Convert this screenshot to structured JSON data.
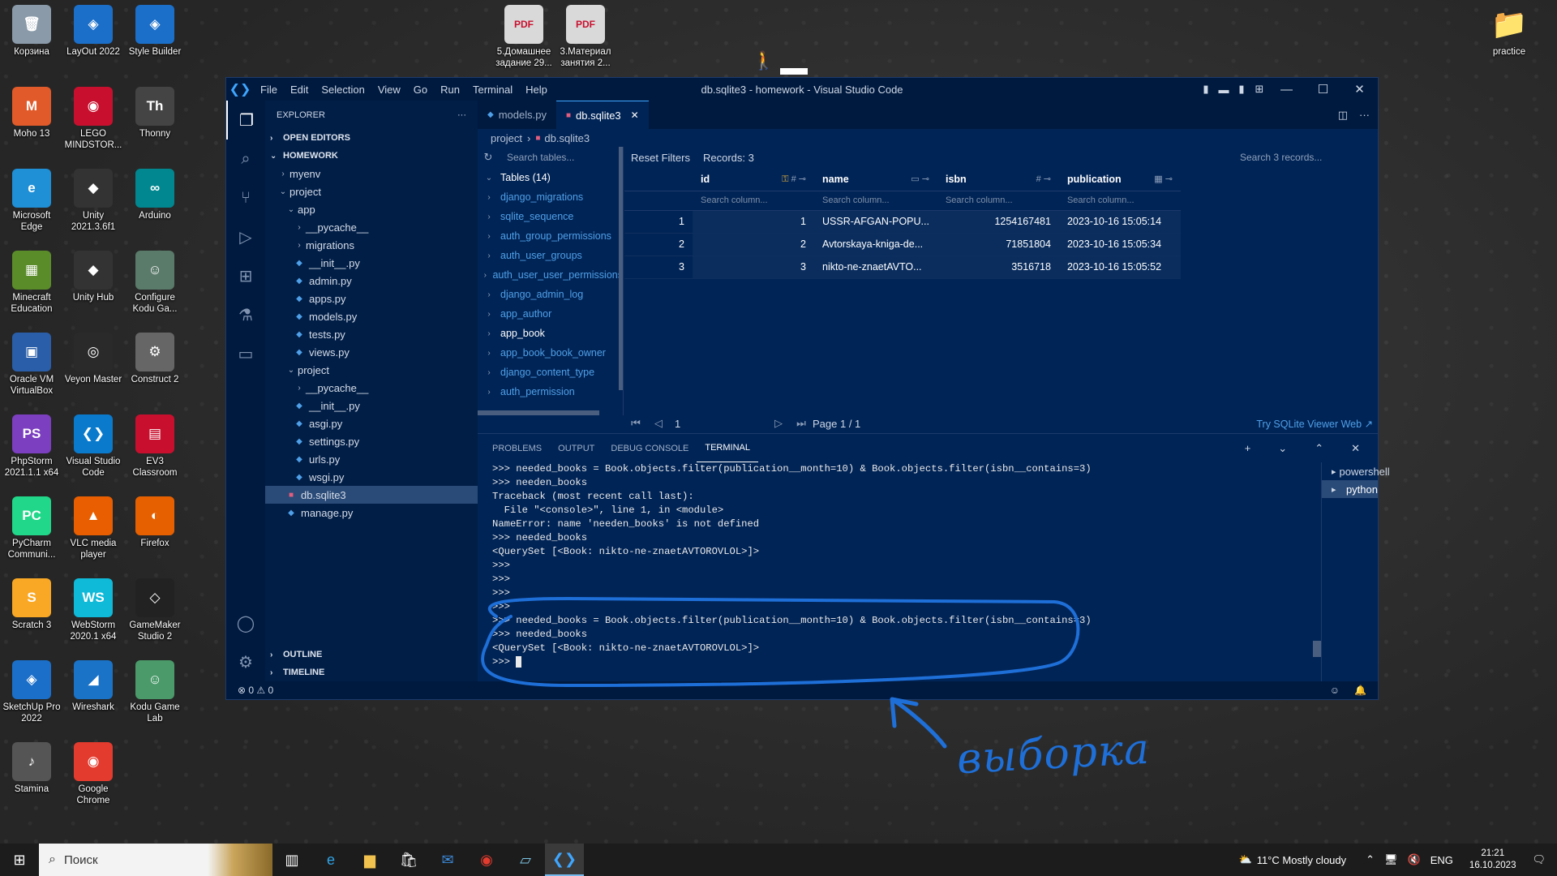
{
  "desktop": {
    "icons_left": [
      {
        "label": "Корзина",
        "color": "#8a9aa8",
        "glyph": "🗑"
      },
      {
        "label": "LayOut 2022",
        "color": "#1b6fc9",
        "glyph": "◈"
      },
      {
        "label": "Style Builder",
        "color": "#1b6fc9",
        "glyph": "◈"
      },
      {
        "label": "Moho 13",
        "color": "#e05a2a",
        "glyph": "M"
      },
      {
        "label": "LEGO MINDSTOR...",
        "color": "#c8102e",
        "glyph": "◉"
      },
      {
        "label": "Thonny",
        "color": "#444",
        "glyph": "Th"
      },
      {
        "label": "Microsoft Edge",
        "color": "#1f8fd6",
        "glyph": "e"
      },
      {
        "label": "Unity 2021.3.6f1",
        "color": "#333",
        "glyph": "◆"
      },
      {
        "label": "Arduino",
        "color": "#00878f",
        "glyph": "∞"
      },
      {
        "label": "Minecraft Education",
        "color": "#5b8c2a",
        "glyph": "▦"
      },
      {
        "label": "Unity Hub",
        "color": "#333",
        "glyph": "◆"
      },
      {
        "label": "Configure Kodu Ga...",
        "color": "#5a7a6a",
        "glyph": "☺"
      },
      {
        "label": "Oracle VM VirtualBox",
        "color": "#2a5ea8",
        "glyph": "▣"
      },
      {
        "label": "Veyon Master",
        "color": "#2a2a2a",
        "glyph": "◎"
      },
      {
        "label": "Construct 2",
        "color": "#666",
        "glyph": "⚙"
      },
      {
        "label": "PhpStorm 2021.1.1 x64",
        "color": "#7b3fbf",
        "glyph": "PS"
      },
      {
        "label": "Visual Studio Code",
        "color": "#0a7acc",
        "glyph": "❮❯"
      },
      {
        "label": "EV3 Classroom",
        "color": "#c8102e",
        "glyph": "▤"
      },
      {
        "label": "PyCharm Communi...",
        "color": "#21d789",
        "glyph": "PC"
      },
      {
        "label": "VLC media player",
        "color": "#e85e00",
        "glyph": "▲"
      },
      {
        "label": "Firefox",
        "color": "#e66000",
        "glyph": "◐"
      },
      {
        "label": "Scratch 3",
        "color": "#f9a825",
        "glyph": "S"
      },
      {
        "label": "WebStorm 2020.1 x64",
        "color": "#0fb9d8",
        "glyph": "WS"
      },
      {
        "label": "GameMaker Studio 2",
        "color": "#222",
        "glyph": "◇"
      },
      {
        "label": "SketchUp Pro 2022",
        "color": "#1b6fc9",
        "glyph": "◈"
      },
      {
        "label": "Wireshark",
        "color": "#1a73c7",
        "glyph": "◢"
      },
      {
        "label": "Kodu Game Lab",
        "color": "#4a9a6a",
        "glyph": "☺"
      },
      {
        "label": "Stamina",
        "color": "#555",
        "glyph": "♪"
      },
      {
        "label": "Google Chrome",
        "color": "#e33b2e",
        "glyph": "◉"
      }
    ],
    "icons_top": [
      {
        "label": "5.Домашнее задание 29...",
        "color": "#d9d9d9",
        "glyph": "PDF"
      },
      {
        "label": "3.Материал занятия 2...",
        "color": "#d9d9d9",
        "glyph": "PDF"
      }
    ],
    "practice": {
      "label": "practice",
      "color": "#e8c46a",
      "glyph": "📁"
    }
  },
  "window": {
    "title": "db.sqlite3 - homework - Visual Studio Code",
    "menu": [
      "File",
      "Edit",
      "Selection",
      "View",
      "Go",
      "Run",
      "Terminal",
      "Help"
    ]
  },
  "explorer": {
    "header": "EXPLORER",
    "sections": {
      "open_editors": "OPEN EDITORS",
      "homework": "HOMEWORK",
      "outline": "OUTLINE",
      "timeline": "TIMELINE"
    },
    "tree": [
      {
        "label": "myenv",
        "kind": "folder",
        "depth": 1,
        "open": false
      },
      {
        "label": "project",
        "kind": "folder",
        "depth": 1,
        "open": true
      },
      {
        "label": "app",
        "kind": "folder",
        "depth": 2,
        "open": true
      },
      {
        "label": "__pycache__",
        "kind": "folder",
        "depth": 3,
        "open": false
      },
      {
        "label": "migrations",
        "kind": "folder",
        "depth": 3,
        "open": false
      },
      {
        "label": "__init__.py",
        "kind": "py",
        "depth": 3
      },
      {
        "label": "admin.py",
        "kind": "py",
        "depth": 3
      },
      {
        "label": "apps.py",
        "kind": "py",
        "depth": 3
      },
      {
        "label": "models.py",
        "kind": "py",
        "depth": 3
      },
      {
        "label": "tests.py",
        "kind": "py",
        "depth": 3
      },
      {
        "label": "views.py",
        "kind": "py",
        "depth": 3
      },
      {
        "label": "project",
        "kind": "folder",
        "depth": 2,
        "open": true
      },
      {
        "label": "__pycache__",
        "kind": "folder",
        "depth": 3,
        "open": false
      },
      {
        "label": "__init__.py",
        "kind": "py",
        "depth": 3
      },
      {
        "label": "asgi.py",
        "kind": "py",
        "depth": 3
      },
      {
        "label": "settings.py",
        "kind": "py",
        "depth": 3
      },
      {
        "label": "urls.py",
        "kind": "py",
        "depth": 3
      },
      {
        "label": "wsgi.py",
        "kind": "py",
        "depth": 3
      },
      {
        "label": "db.sqlite3",
        "kind": "db",
        "depth": 2,
        "selected": true
      },
      {
        "label": "manage.py",
        "kind": "py",
        "depth": 2
      }
    ]
  },
  "tabs": [
    {
      "label": "models.py",
      "kind": "py",
      "active": false
    },
    {
      "label": "db.sqlite3",
      "kind": "db",
      "active": true
    }
  ],
  "breadcrumb": {
    "folder": "project",
    "file": "db.sqlite3"
  },
  "sqlite": {
    "search_tables_placeholder": "Search tables...",
    "tables_header": "Tables (14)",
    "tables": [
      "django_migrations",
      "sqlite_sequence",
      "auth_group_permissions",
      "auth_user_groups",
      "auth_user_user_permissions",
      "django_admin_log",
      "app_author",
      "app_book",
      "app_book_book_owner",
      "django_content_type",
      "auth_permission"
    ],
    "current_table": "app_book",
    "reset_filters": "Reset Filters",
    "records": "Records: 3",
    "search_records_placeholder": "Search 3 records...",
    "columns": [
      "id",
      "name",
      "isbn",
      "publication"
    ],
    "filter_placeholder": "Search column...",
    "rows": [
      {
        "n": "1",
        "id": "1",
        "name": "USSR-AFGAN-POPU...",
        "isbn": "1254167481",
        "publication": "2023-10-16 15:05:14"
      },
      {
        "n": "2",
        "id": "2",
        "name": "Avtorskaya-kniga-de...",
        "isbn": "71851804",
        "publication": "2023-10-16 15:05:34"
      },
      {
        "n": "3",
        "id": "3",
        "name": "nikto-ne-znaetAVTO...",
        "isbn": "3516718",
        "publication": "2023-10-16 15:05:52"
      }
    ],
    "page_input": "1",
    "page_label": "Page 1 / 1",
    "try_link": "Try SQLite Viewer Web ↗"
  },
  "panel": {
    "tabs": [
      "PROBLEMS",
      "OUTPUT",
      "DEBUG CONSOLE",
      "TERMINAL"
    ],
    "active_tab": "TERMINAL",
    "terminal_lines": [
      ">>> needed_books = Book.objects.filter(publication__month=10) & Book.objects.filter(isbn__contains=3)",
      ">>> needen_books",
      "Traceback (most recent call last):",
      "  File \"<console>\", line 1, in <module>",
      "NameError: name 'needen_books' is not defined",
      ">>> needed_books",
      "<QuerySet [<Book: nikto-ne-znaetAVTOROVLOL>]>",
      ">>>",
      ">>>",
      ">>>",
      ">>>",
      ">>> needed_books = Book.objects.filter(publication__month=10) & Book.objects.filter(isbn__contains=3)",
      ">>> needed_books",
      "<QuerySet [<Book: nikto-ne-znaetAVTOROVLOL>]>"
    ],
    "prompt": ">>> ",
    "terminals": [
      {
        "label": "powershell",
        "selected": false
      },
      {
        "label": "python",
        "selected": true
      }
    ]
  },
  "status": {
    "errors": "0",
    "warnings": "0"
  },
  "annotation": {
    "text": "выборка",
    "color": "#1e6fd8"
  },
  "taskbar": {
    "search_placeholder": "Поиск",
    "weather": "11°C  Mostly cloudy",
    "lang": "ENG",
    "time": "21:21",
    "date": "16.10.2023"
  }
}
